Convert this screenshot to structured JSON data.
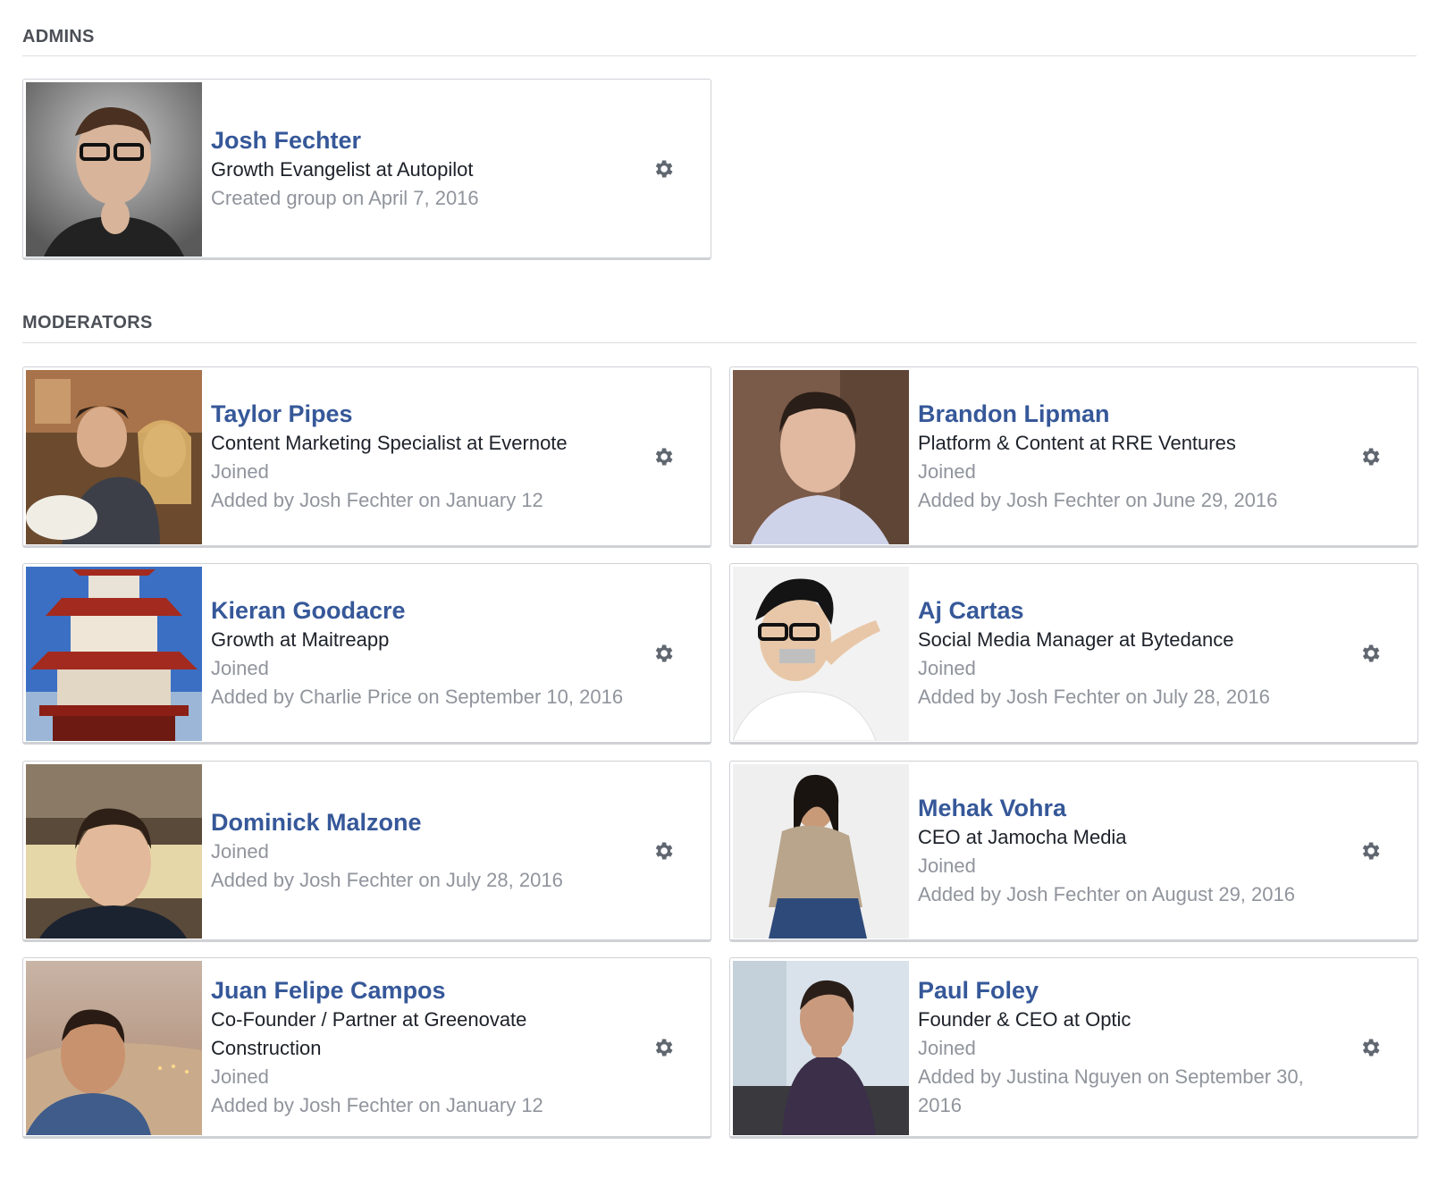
{
  "sections": {
    "admins": {
      "title": "ADMINS"
    },
    "moderators": {
      "title": "MODERATORS"
    }
  },
  "admins": [
    {
      "name": "Josh Fechter",
      "title": "Growth Evangelist at Autopilot",
      "meta": "Created group on April 7, 2016"
    }
  ],
  "moderators": [
    {
      "name": "Taylor Pipes",
      "title": "Content Marketing Specialist at Evernote",
      "status": "Joined",
      "added": "Added by Josh Fechter on January 12"
    },
    {
      "name": "Brandon Lipman",
      "title": "Platform & Content at RRE Ventures",
      "status": "Joined",
      "added": "Added by Josh Fechter on June 29, 2016"
    },
    {
      "name": "Kieran Goodacre",
      "title": "Growth at Maitreapp",
      "status": "Joined",
      "added": "Added by Charlie Price on September 10, 2016"
    },
    {
      "name": "Aj Cartas",
      "title": "Social Media Manager at Bytedance",
      "status": "Joined",
      "added": "Added by Josh Fechter on July 28, 2016"
    },
    {
      "name": "Dominick Malzone",
      "title": "",
      "status": "Joined",
      "added": "Added by Josh Fechter on July 28, 2016"
    },
    {
      "name": "Mehak Vohra",
      "title": "CEO at Jamocha Media",
      "status": "Joined",
      "added": "Added by Josh Fechter on August 29, 2016"
    },
    {
      "name": "Juan Felipe Campos",
      "title": "Co-Founder / Partner at Greenovate Construction",
      "status": "Joined",
      "added": "Added by Josh Fechter on January 12"
    },
    {
      "name": "Paul Foley",
      "title": "Founder & CEO at Optic",
      "status": "Joined",
      "added": "Added by Justina Nguyen on September 30, 2016"
    }
  ],
  "icons": {
    "settings": "gear-icon",
    "profile_photo": "avatar"
  },
  "colors": {
    "name_link": "#365899",
    "meta_text": "#90949c",
    "body_text": "#1d2129",
    "section_title": "#4b4f56",
    "gear": "#616770"
  }
}
